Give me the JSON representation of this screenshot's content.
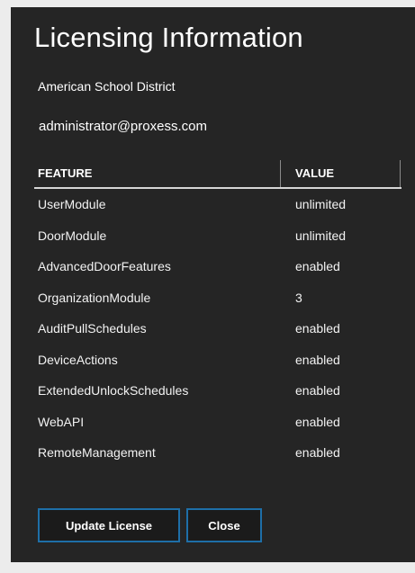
{
  "dialog": {
    "title": "Licensing Information",
    "organization": "American School District",
    "email": "administrator@proxess.com"
  },
  "table": {
    "headers": {
      "feature": "FEATURE",
      "value": "VALUE"
    },
    "rows": [
      {
        "feature": "UserModule",
        "value": "unlimited"
      },
      {
        "feature": "DoorModule",
        "value": "unlimited"
      },
      {
        "feature": "AdvancedDoorFeatures",
        "value": "enabled"
      },
      {
        "feature": "OrganizationModule",
        "value": "3"
      },
      {
        "feature": "AuditPullSchedules",
        "value": "enabled"
      },
      {
        "feature": "DeviceActions",
        "value": "enabled"
      },
      {
        "feature": "ExtendedUnlockSchedules",
        "value": "enabled"
      },
      {
        "feature": "WebAPI",
        "value": "enabled"
      },
      {
        "feature": "RemoteManagement",
        "value": "enabled"
      }
    ]
  },
  "buttons": {
    "update_label": "Update License",
    "close_label": "Close"
  },
  "colors": {
    "dialog_background": "#252525",
    "page_background": "#ececec",
    "button_border": "#1e6fa8",
    "text": "#ffffff"
  }
}
